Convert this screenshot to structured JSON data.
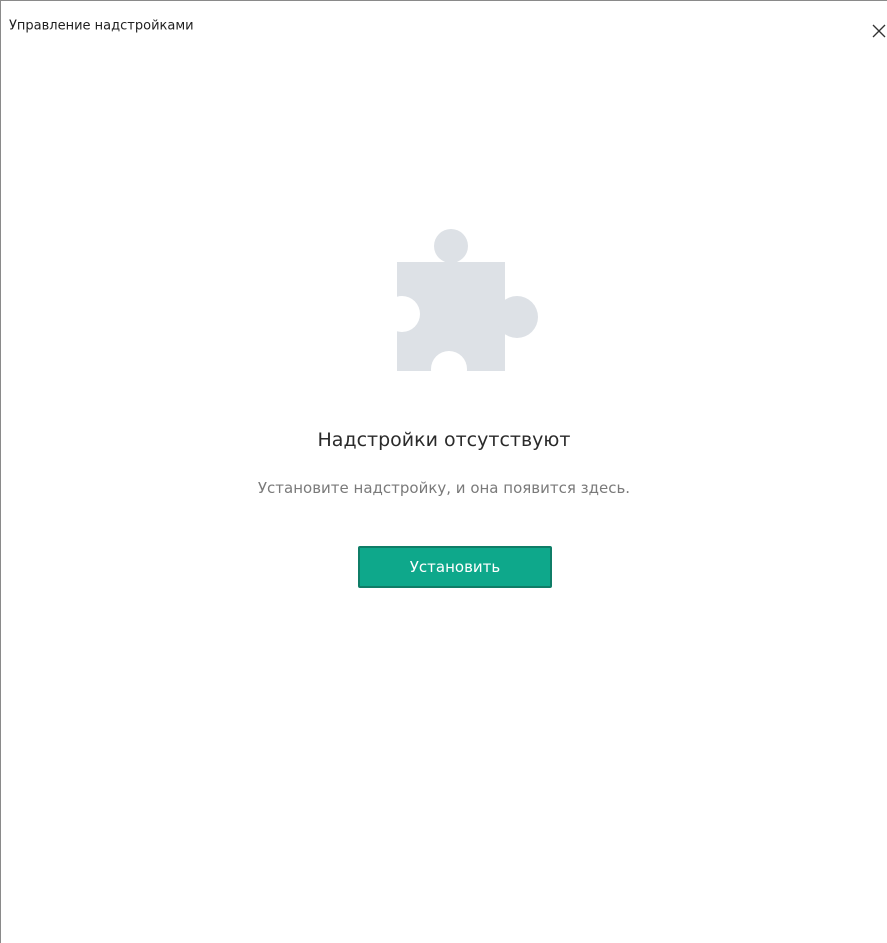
{
  "window": {
    "title": "Управление надстройками",
    "close_icon": "close-icon"
  },
  "empty_state": {
    "icon": "puzzle-piece-icon",
    "title": "Надстройки отсутствуют",
    "subtitle": "Установите надстройку, и она появится здесь.",
    "install_label": "Установить"
  },
  "colors": {
    "accent": "#0ea88b",
    "accent_border": "#0f7d67",
    "icon_fill": "#dde1e6",
    "subtitle_text": "#7a7a7a"
  }
}
